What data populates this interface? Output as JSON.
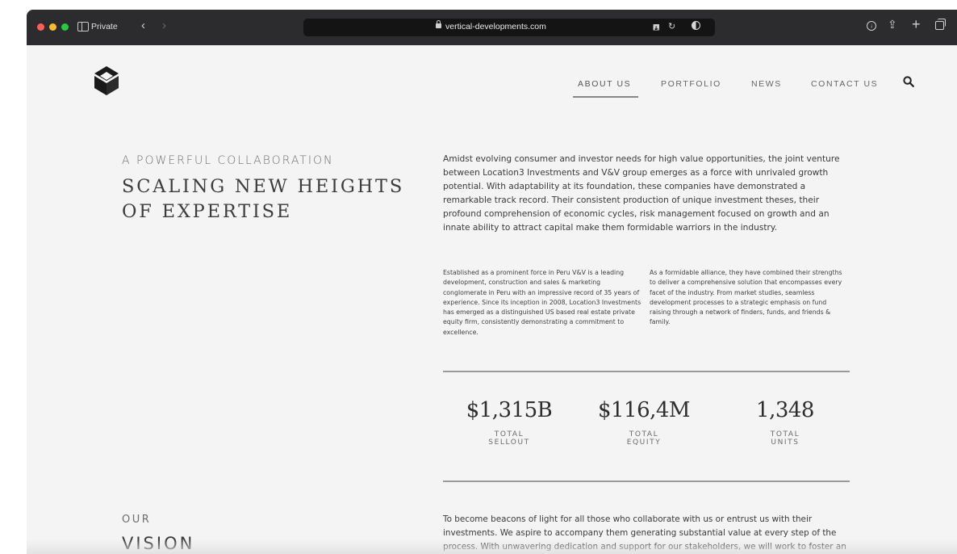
{
  "browser": {
    "mode_label": "Private",
    "url": "vertical-developments.com"
  },
  "nav": {
    "items": [
      {
        "label": "ABOUT US"
      },
      {
        "label": "PORTFOLIO"
      },
      {
        "label": "NEWS"
      },
      {
        "label": "CONTACT US"
      }
    ],
    "active": "ABOUT US"
  },
  "hero": {
    "eyebrow": "A POWERFUL COLLABORATION",
    "headline_line1": "SCALING NEW HEIGHTS",
    "headline_line2": "OF EXPERTISE",
    "intro": "Amidst evolving consumer and investor needs for high value opportunities, the joint venture between Location3 Investments and V&V group emerges as a force with unrivaled growth potential. With adaptability at its foundation, these companies have demonstrated a remarkable track record. Their consistent production of unique investment theses, their profound comprehension of economic cycles, risk management focused on growth and an innate ability to attract capital make them formidable warriors in the industry.",
    "col_left": "Established as a prominent force in Peru V&V is a leading development, construction and sales & marketing conglomerate in Peru with an impressive record of 35 years of experience. Since its inception in 2008, Location3 Investments has emerged as a distinguished US based real estate private equity firm, consistently demonstrating a commitment to excellence.",
    "col_right": "As a formidable alliance, they have combined their strengths to deliver a comprehensive solution that encompasses every facet of the industry. From market studies, seamless development processes to a strategic emphasis on fund raising through a network of finders, funds, and friends & family."
  },
  "stats": [
    {
      "value": "$1,315B",
      "label_line1": "TOTAL",
      "label_line2": "SELLOUT"
    },
    {
      "value": "$116,4M",
      "label_line1": "TOTAL",
      "label_line2": "EQUITY"
    },
    {
      "value": "1,348",
      "label_line1": "TOTAL",
      "label_line2": "UNITS"
    }
  ],
  "vision": {
    "eyebrow": "OUR",
    "title": "VISION",
    "text": "To become beacons of light for all those who collaborate with us or entrust us with their investments. We aspire to accompany them generating substantial value at every step of the process. With unwavering dedication and support for our stakeholders, we will work to foster an environment of trust, transparency and expertise, seeking to ensure"
  },
  "icons": {
    "logo": "cube-logo-icon",
    "search": "search-icon"
  }
}
